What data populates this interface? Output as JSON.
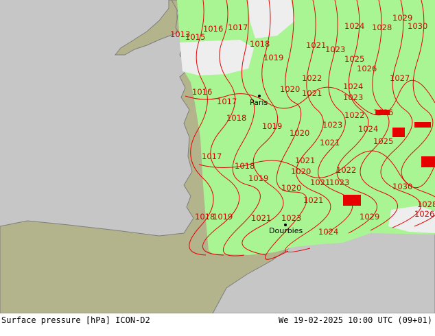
{
  "footer": {
    "left": "Surface pressure [hPa] ICON-D2",
    "right": "We 19-02-2025 10:00 UTC (09+01)"
  },
  "colors": {
    "sea": "#c6c6c6",
    "land": "#b3b38c",
    "domain": "#a9f593",
    "outside_domain": "#eeeeee",
    "isobar": "#e60000",
    "coast": "#7d7d7d"
  },
  "cities": [
    {
      "name": "Paris",
      "id": "paris"
    },
    {
      "name": "Dourbies",
      "id": "dourbies"
    }
  ],
  "isobar_labels": [
    "1016",
    "1017",
    "1013",
    "1015",
    "1018",
    "1019",
    "1021",
    "1023",
    "1024",
    "1028",
    "1029",
    "1030",
    "1025",
    "1026",
    "1022",
    "1020",
    "1016",
    "1017",
    "1018",
    "1019",
    "1020",
    "1021",
    "1023",
    "1024",
    "1027",
    "1022",
    "1023",
    "1024",
    "1021",
    "1025",
    "1026",
    "1017",
    "1018",
    "1019",
    "1020",
    "1021",
    "1022",
    "1020",
    "1021",
    "1023",
    "1030",
    "1018",
    "1019",
    "1021",
    "1021",
    "1023",
    "1024",
    "1029",
    "1026",
    "1028"
  ]
}
